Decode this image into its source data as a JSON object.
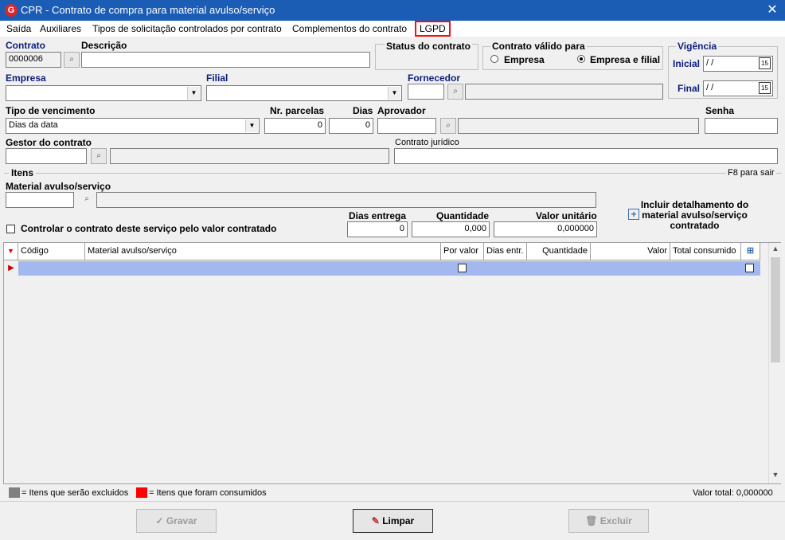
{
  "window": {
    "title": "CPR - Contrato de compra para material avulso/serviço",
    "close": "✕",
    "app_icon": "G"
  },
  "menu": [
    "Saída",
    "Auxiliares",
    "Tipos de solicitação controlados por contrato",
    "Complementos do contrato",
    "LGPD"
  ],
  "contrato": {
    "label": "Contrato",
    "value": "0000006"
  },
  "descricao": {
    "label": "Descrição",
    "value": ""
  },
  "status": {
    "label": "Status do contrato"
  },
  "validade": {
    "label": "Contrato válido para",
    "opt1": "Empresa",
    "opt2": "Empresa e filial",
    "selected": "Empresa e filial"
  },
  "vigencia": {
    "label": "Vigência",
    "inicial_label": "Inicial",
    "inicial_value": " /  /",
    "final_label": "Final",
    "final_value": " /  /",
    "cal": "15"
  },
  "empresa": {
    "label": "Empresa",
    "value": ""
  },
  "filial": {
    "label": "Filial",
    "value": ""
  },
  "fornecedor": {
    "label": "Fornecedor",
    "value": ""
  },
  "vencimento": {
    "label": "Tipo de vencimento",
    "value": "Dias da data"
  },
  "parcelas": {
    "label": "Nr. parcelas",
    "value": "0"
  },
  "dias": {
    "label": "Dias",
    "value": "0"
  },
  "aprovador": {
    "label": "Aprovador",
    "value": ""
  },
  "senha": {
    "label": "Senha",
    "value": ""
  },
  "gestor": {
    "label": "Gestor do contrato",
    "value": ""
  },
  "juridico": {
    "label": "Contrato jurídico",
    "value": ""
  },
  "itens": {
    "label": "Itens",
    "hint": "F8 para sair"
  },
  "material": {
    "label": "Material avulso/serviço",
    "code": "",
    "desc": ""
  },
  "controlar": {
    "label": "Controlar o contrato deste serviço pelo valor contratado",
    "checked": false
  },
  "entrega": {
    "label": "Dias entrega",
    "value": "0"
  },
  "quantidade": {
    "label": "Quantidade",
    "value": "0,000"
  },
  "valor_unit": {
    "label": "Valor unitário",
    "value": "0,000000"
  },
  "incluir": {
    "label": "Incluir detalhamento do material avulso/serviço contratado"
  },
  "grid": {
    "columns": [
      "Código",
      "Material avulso/serviço",
      "Por valor",
      "Dias entr.",
      "Quantidade",
      "Valor",
      "Total consumido"
    ]
  },
  "legend": {
    "excluidos": "= Itens que serão excluidos",
    "consumidos": "= Itens que foram consumidos",
    "total": "Valor total: 0,000000",
    "color_excluidos": "#808080",
    "color_consumidos": "#ff0000"
  },
  "buttons": {
    "gravar": "Gravar",
    "limpar": "Limpar",
    "excluir": "Excluir"
  },
  "colors": {
    "titlebar": "#1b5db5",
    "selected_row": "#a3b8ef",
    "highlight": "#e11111"
  }
}
